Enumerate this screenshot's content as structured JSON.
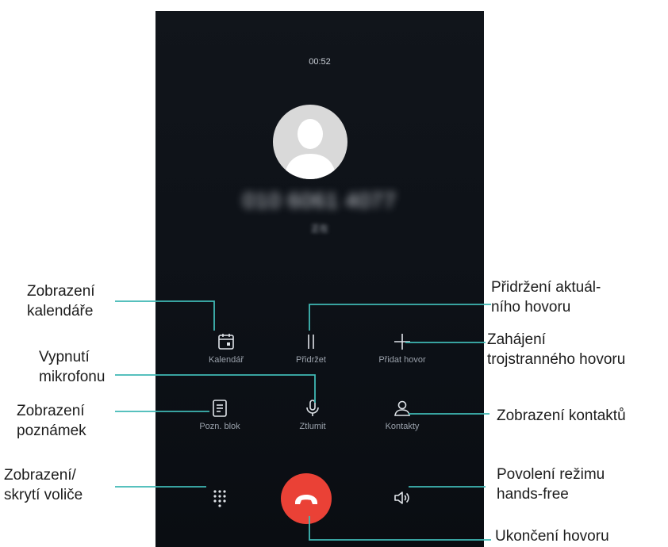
{
  "call": {
    "timer": "00:52",
    "number": "010 6061 4077",
    "subtext": "正在"
  },
  "controls": [
    {
      "label": "Kalendář",
      "icon": "calendar-icon"
    },
    {
      "label": "Přidržet",
      "icon": "pause-icon"
    },
    {
      "label": "Přidat hovor",
      "icon": "plus-icon"
    },
    {
      "label": "Pozn. blok",
      "icon": "notepad-icon"
    },
    {
      "label": "Ztlumit",
      "icon": "microphone-icon"
    },
    {
      "label": "Kontakty",
      "icon": "contacts-icon"
    }
  ],
  "bottom": {
    "dialpad_icon": "dialpad-icon",
    "end_call_icon": "phone-hangup-icon",
    "speaker_icon": "speaker-icon"
  },
  "annotations": {
    "calendar": [
      "Zobrazení",
      "kalendáře"
    ],
    "hold": [
      "Přidržení aktuál-",
      "ního hovoru"
    ],
    "add_call": [
      "Zahájení",
      "trojstranného hovoru"
    ],
    "mute": [
      "Vypnutí",
      "mikrofonu"
    ],
    "notes": [
      "Zobrazení",
      "poznámek"
    ],
    "contacts": [
      "Zobrazení kontaktů"
    ],
    "dialpad": [
      "Zobrazení/",
      "skrytí voliče"
    ],
    "speaker": [
      "Povolení režimu",
      "hands-free"
    ],
    "end_call": [
      "Ukončení hovoru"
    ]
  },
  "colors": {
    "accent_line": "#3fb8b4",
    "end_call": "#ea4136",
    "screen_bg": "#0d1117"
  }
}
